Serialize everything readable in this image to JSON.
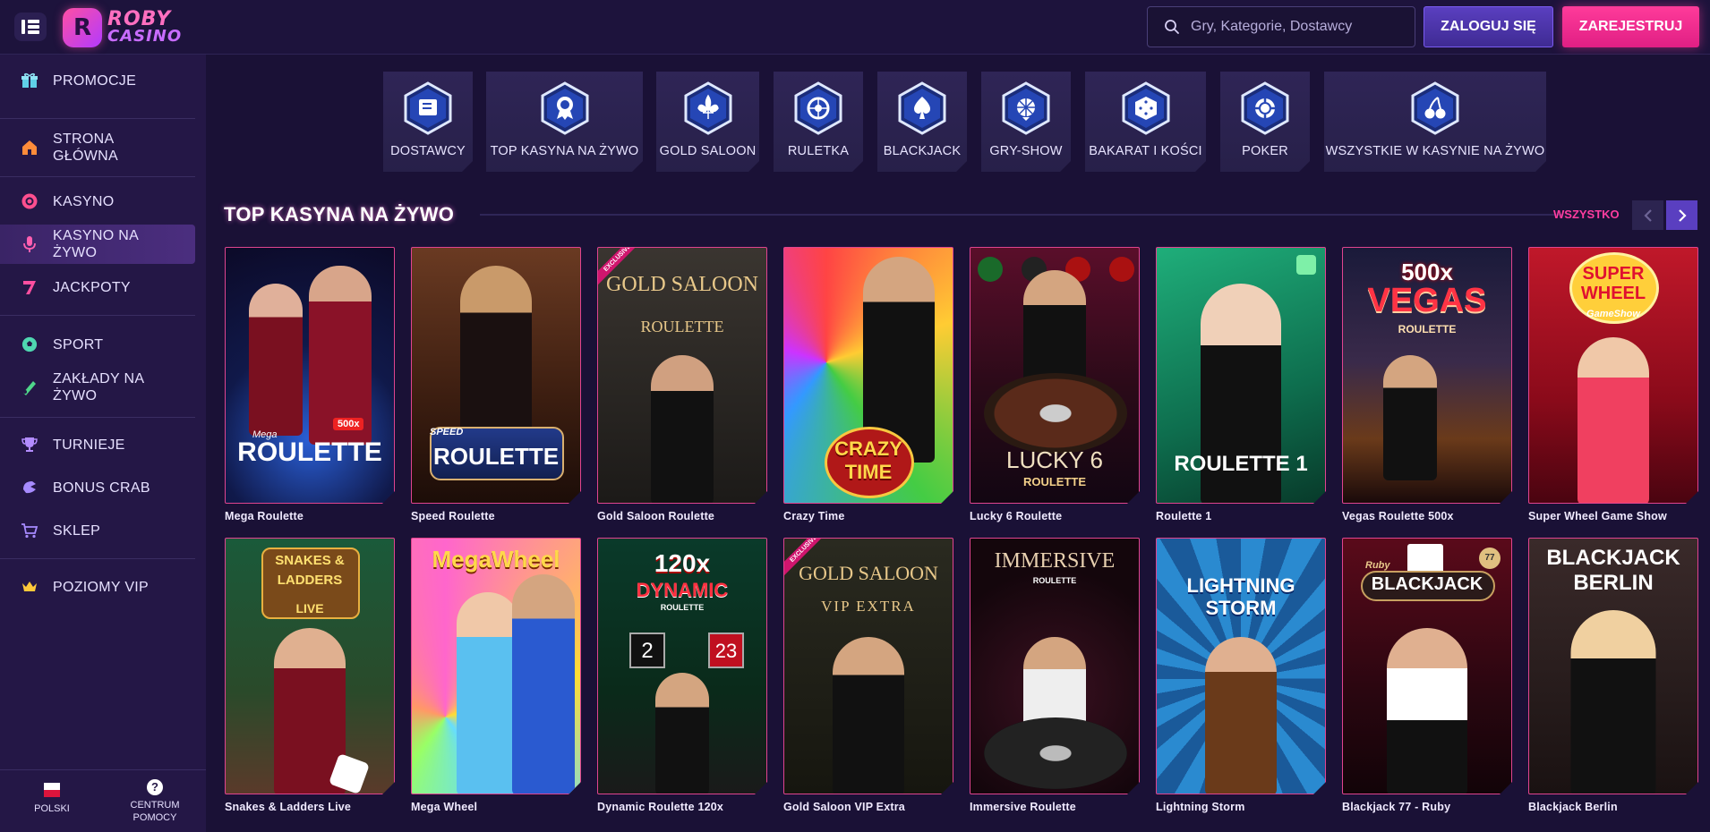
{
  "header": {
    "logo_line1": "ROBY",
    "logo_line2": "CASINO",
    "logo_mark": "R",
    "search_placeholder": "Gry, Kategorie, Dostawcy",
    "login_label": "ZALOGUJ SIĘ",
    "register_label": "ZAREJESTRUJ"
  },
  "sidebar": {
    "items": [
      {
        "label": "PROMOCJE",
        "icon": "gift-icon"
      },
      {
        "label": "STRONA GŁÓWNA",
        "icon": "home-icon"
      },
      {
        "label": "KASYNO",
        "icon": "casino-chip-icon"
      },
      {
        "label": "KASYNO NA ŻYWO",
        "icon": "microphone-icon"
      },
      {
        "label": "JACKPOTY",
        "icon": "seven-icon"
      },
      {
        "label": "SPORT",
        "icon": "soccer-ball-icon"
      },
      {
        "label": "ZAKŁADY NA ŻYWO",
        "icon": "live-bet-icon"
      },
      {
        "label": "TURNIEJE",
        "icon": "trophy-icon"
      },
      {
        "label": "BONUS CRAB",
        "icon": "crab-claw-icon"
      },
      {
        "label": "SKLEP",
        "icon": "cart-icon"
      },
      {
        "label": "POZIOMY VIP",
        "icon": "crown-icon"
      }
    ],
    "footer": {
      "language": "POLSKI",
      "help_line1": "CENTRUM",
      "help_line2": "POMOCY"
    }
  },
  "categories": [
    {
      "label": "DOSTAWCY",
      "icon": "providers-icon"
    },
    {
      "label": "TOP KASYNA NA ŻYWO",
      "icon": "medal-icon"
    },
    {
      "label": "GOLD SALOON",
      "icon": "fleur-de-lis-icon"
    },
    {
      "label": "RULETKA",
      "icon": "roulette-icon"
    },
    {
      "label": "BLACKJACK",
      "icon": "spade-icon"
    },
    {
      "label": "GRY-SHOW",
      "icon": "wheel-icon"
    },
    {
      "label": "BAKARAT I KOŚCI",
      "icon": "dice-icon"
    },
    {
      "label": "POKER",
      "icon": "poker-chip-icon"
    },
    {
      "label": "WSZYSTKIE W KASYNIE NA ŻYWO",
      "icon": "cherries-icon"
    }
  ],
  "section": {
    "title": "TOP KASYNA NA ŻYWO",
    "see_all": "WSZYSTKO"
  },
  "games": [
    {
      "name": "Mega Roulette",
      "art": "ROULETTE",
      "art_sub": "Mega",
      "badge": "500x",
      "exclusive": ""
    },
    {
      "name": "Speed Roulette",
      "art": "ROULETTE",
      "art_sub": "SPEED",
      "badge": "",
      "exclusive": ""
    },
    {
      "name": "Gold Saloon Roulette",
      "art": "GOLD SALOON",
      "art_sub": "ROULETTE",
      "badge": "",
      "exclusive": "EXCLUSIVE"
    },
    {
      "name": "Crazy Time",
      "art": "CRAZY TIME",
      "art_sub": "",
      "badge": "",
      "exclusive": ""
    },
    {
      "name": "Lucky 6 Roulette",
      "art": "LUCKY 6",
      "art_sub": "ROULETTE",
      "badge": "",
      "exclusive": ""
    },
    {
      "name": "Roulette 1",
      "art": "ROULETTE 1",
      "art_sub": "",
      "badge": "",
      "exclusive": ""
    },
    {
      "name": "Vegas Roulette 500x",
      "art": "VEGAS",
      "art_sub": "ROULETTE",
      "badge": "500x",
      "exclusive": ""
    },
    {
      "name": "Super Wheel Game Show",
      "art": "SUPER WHEEL",
      "art_sub": "GameShow",
      "badge": "",
      "exclusive": ""
    },
    {
      "name": "Snakes & Ladders Live",
      "art": "SNAKES & LADDERS",
      "art_sub": "LIVE",
      "badge": "",
      "exclusive": ""
    },
    {
      "name": "Mega Wheel",
      "art": "MegaWheel",
      "art_sub": "",
      "badge": "",
      "exclusive": ""
    },
    {
      "name": "Dynamic Roulette 120x",
      "art": "DYNAMIC",
      "art_sub": "ROULETTE",
      "badge": "120x",
      "exclusive": ""
    },
    {
      "name": "Gold Saloon VIP Extra",
      "art": "GOLD SALOON",
      "art_sub": "VIP EXTRA",
      "badge": "",
      "exclusive": "EXCLUSIVE"
    },
    {
      "name": "Immersive Roulette",
      "art": "IMMERSIVE",
      "art_sub": "ROULETTE",
      "badge": "",
      "exclusive": ""
    },
    {
      "name": "Lightning Storm",
      "art": "LIGHTNING",
      "art_sub": "STORM",
      "badge": "",
      "exclusive": ""
    },
    {
      "name": "Blackjack 77 - Ruby",
      "art": "BLACKJACK",
      "art_sub": "Ruby",
      "badge": "77",
      "exclusive": ""
    },
    {
      "name": "Blackjack Berlin",
      "art": "BLACKJACK",
      "art_sub": "BERLIN",
      "badge": "",
      "exclusive": ""
    }
  ],
  "colors": {
    "accent_pink": "#ff3da0",
    "accent_purple": "#5a3fc0",
    "background": "#1a1136",
    "sidebar": "#241746"
  }
}
